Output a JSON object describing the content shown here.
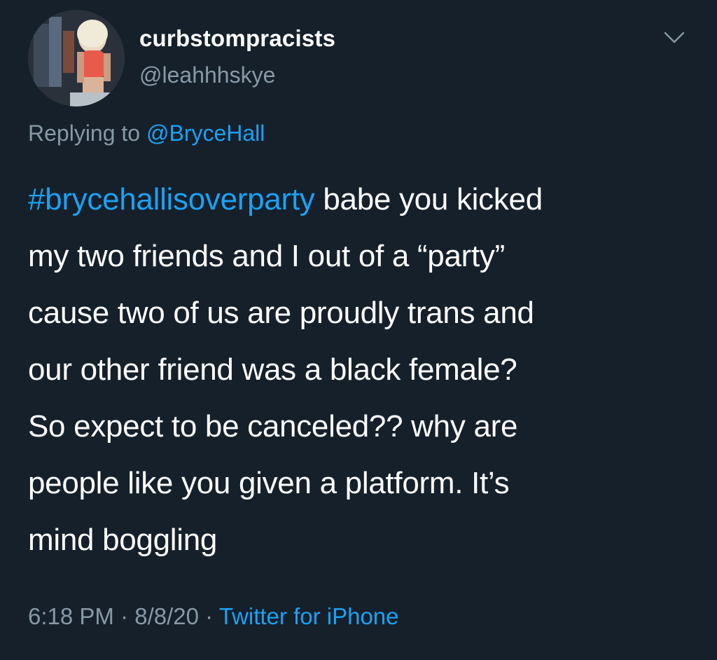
{
  "user": {
    "display_name": "curbstompracists",
    "handle": "@leahhhskye"
  },
  "reply": {
    "prefix": "Replying to ",
    "mention": "@BryceHall"
  },
  "tweet": {
    "hashtag": "#brycehallisoverparty",
    "lines": [
      " babe you kicked",
      "my two friends and I out of a “party”",
      "cause two of us are proudly trans and",
      "our other friend was a black female?",
      "So expect to be canceled?? why are",
      "people like you given a platform. It’s",
      "mind boggling"
    ]
  },
  "meta": {
    "time": "6:18 PM",
    "separator": " · ",
    "date": "8/8/20",
    "separator2": " · ",
    "source": "Twitter for iPhone"
  },
  "icons": {
    "avatar": "avatar-photo",
    "chevron": "chevron-down-icon"
  },
  "colors": {
    "background": "#15202b",
    "link": "#1da1f2",
    "secondary_text": "#8899a6",
    "primary_text": "#ffffff"
  }
}
